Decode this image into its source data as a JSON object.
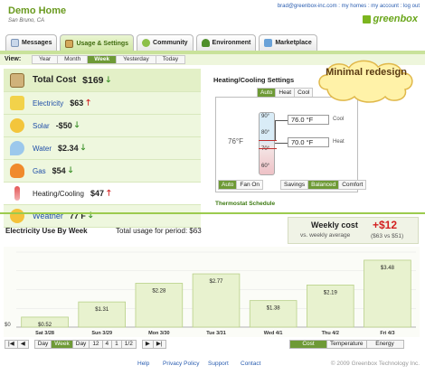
{
  "header": {
    "title": "Demo Home",
    "location": "San Bruno, CA",
    "links": "brad@greenbox-inc.com : my homes : my account : log out",
    "logo_text": "greenbox"
  },
  "tabs": [
    {
      "label": "Messages",
      "icon": "mail-icon"
    },
    {
      "label": "Usage & Settings",
      "icon": "house-icon",
      "active": true
    },
    {
      "label": "Community",
      "icon": "community-icon"
    },
    {
      "label": "Environment",
      "icon": "tree-icon"
    },
    {
      "label": "Marketplace",
      "icon": "cart-icon"
    }
  ],
  "view": {
    "label": "View:",
    "options": [
      "Year",
      "Month",
      "Week",
      "Yesterday",
      "Today"
    ],
    "selected": "Week"
  },
  "summary": [
    {
      "name": "Total Cost",
      "value": "$169",
      "trend": "down",
      "icon": "house-icon"
    },
    {
      "name": "Electricity",
      "value": "$63",
      "trend": "up",
      "icon": "lightning-icon"
    },
    {
      "name": "Solar",
      "value": "-$50",
      "trend": "down",
      "icon": "sun-icon"
    },
    {
      "name": "Water",
      "value": "$2.34",
      "trend": "down",
      "icon": "water-drop-icon"
    },
    {
      "name": "Gas",
      "value": "$54",
      "trend": "down",
      "icon": "flame-icon"
    },
    {
      "name": "Heating/Cooling",
      "value": "$47",
      "trend": "up",
      "icon": "thermometer-icon"
    },
    {
      "name": "Weather",
      "value": "77 F",
      "trend": "down",
      "icon": "weather-icon"
    }
  ],
  "heating_cooling": {
    "title": "Heating/Cooling Settings",
    "modes": [
      "Auto",
      "Heat",
      "Cool"
    ],
    "selected_mode": "Auto",
    "current_temp": "76°F",
    "scale": [
      "90°",
      "80°",
      "70°",
      "60°"
    ],
    "cool_setpoint": "76.0 °F",
    "heat_setpoint": "70.0 °F",
    "cool_label": "Cool",
    "heat_label": "Heat",
    "fan_options": [
      "Auto",
      "Fan On"
    ],
    "fan_selected": "Auto",
    "profiles": [
      "Savings",
      "Balanced",
      "Comfort"
    ],
    "profile_selected": "Balanced",
    "schedule_link": "Thermostat Schedule"
  },
  "callout": {
    "text": "Minimal redesign"
  },
  "weekly": {
    "label": "Weekly cost",
    "delta": "+$12",
    "avg_label": "vs. weekly average",
    "detail": "($63 vs $51)"
  },
  "chart_title": "Electricity Use By Week",
  "chart_total": "Total usage for period: $63",
  "chart_data": {
    "type": "bar",
    "categories": [
      "Sat 3/28",
      "Sun 3/29",
      "Mon 3/30",
      "Tue 3/31",
      "Wed 4/1",
      "Thu 4/2",
      "Fri 4/3"
    ],
    "values": [
      0.52,
      1.31,
      2.28,
      2.77,
      1.38,
      2.19,
      3.48
    ],
    "value_labels": [
      "$0.52",
      "$1.31",
      "$2.28",
      "$2.77",
      "$1.38",
      "$2.19",
      "$3.48"
    ],
    "y_tick_labels": [
      "$0"
    ],
    "ylim": [
      0,
      3.9
    ],
    "grid": true,
    "bar_color": "#e8f2cf"
  },
  "pager": {
    "buttons": [
      "|◀",
      "◀",
      "Day",
      "Week",
      "Day",
      "12",
      "4",
      "1",
      "1/2",
      "▶",
      "▶|"
    ],
    "selected": "Week"
  },
  "metric_tabs": {
    "options": [
      "Cost",
      "Temperature",
      "Energy"
    ],
    "selected": "Cost"
  },
  "footer": {
    "links": [
      "Help",
      "Privacy Policy",
      "Support",
      "Contact"
    ],
    "copyright": "© 2009 Greenbox Technology Inc."
  },
  "colors": {
    "accent": "#6e9a36",
    "up": "#d32020",
    "down": "#2f8a1d",
    "link": "#2a5db0"
  }
}
